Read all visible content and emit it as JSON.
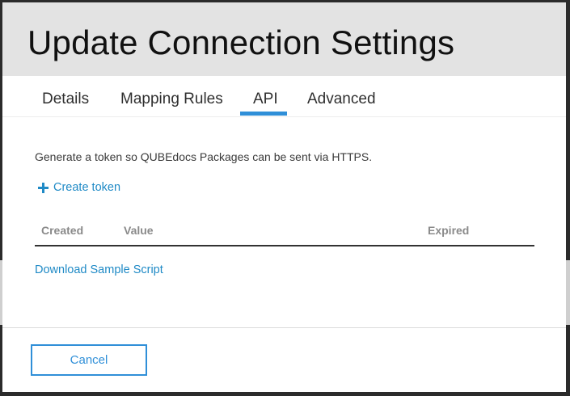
{
  "dialog": {
    "title": "Update Connection Settings"
  },
  "tabs": [
    {
      "label": "Details",
      "active": false
    },
    {
      "label": "Mapping Rules",
      "active": false
    },
    {
      "label": "API",
      "active": true
    },
    {
      "label": "Advanced",
      "active": false
    }
  ],
  "api": {
    "description": "Generate a token so QUBEdocs Packages can be sent via HTTPS.",
    "create_token_label": "Create token",
    "table": {
      "columns": [
        "Created",
        "Value",
        "Expired"
      ],
      "rows": []
    },
    "download_label": "Download Sample Script"
  },
  "footer": {
    "cancel_label": "Cancel"
  },
  "colors": {
    "accent": "#2f8fd8",
    "link": "#1f8ac6",
    "header_bg": "#e3e3e3"
  }
}
